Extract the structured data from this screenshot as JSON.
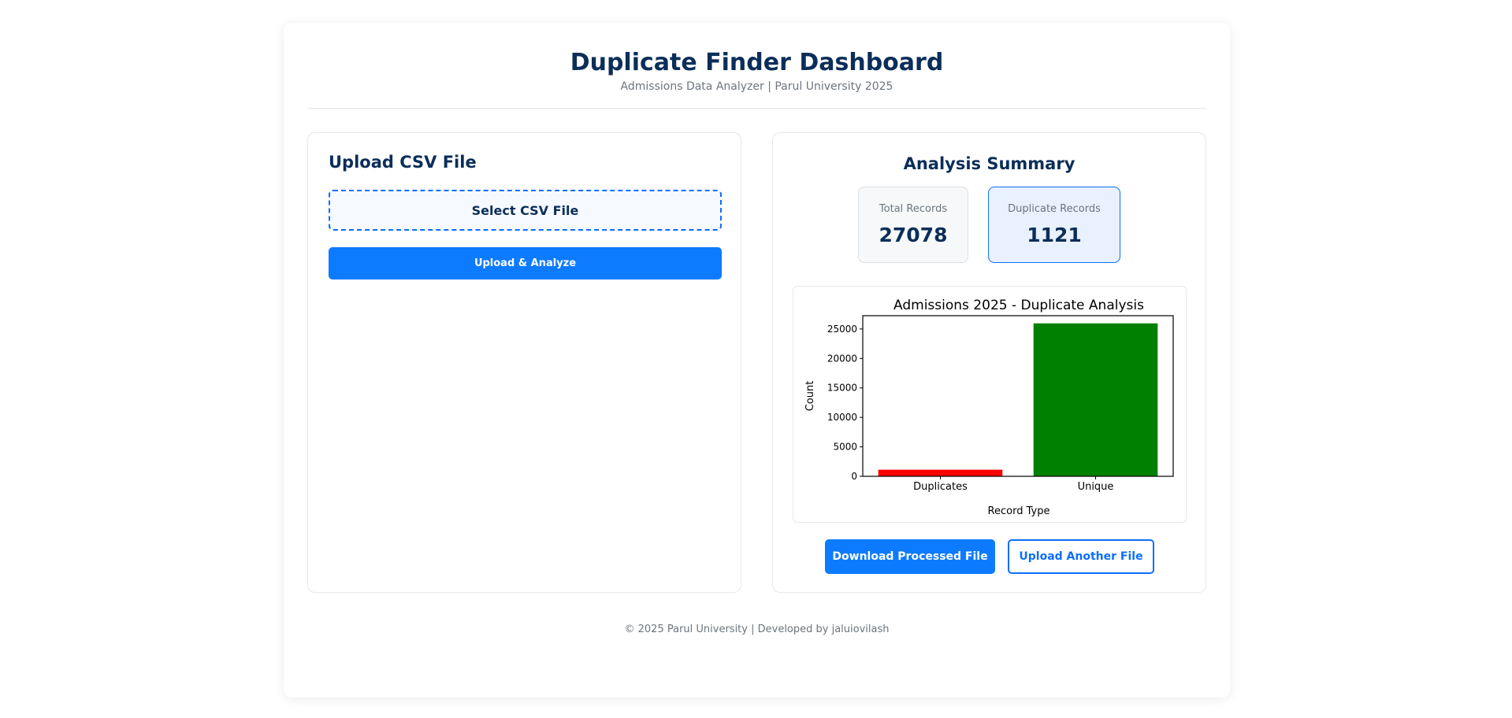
{
  "header": {
    "title": "Duplicate Finder Dashboard",
    "subtitle": "Admissions Data Analyzer | Parul University 2025"
  },
  "upload": {
    "title": "Upload CSV File",
    "select_label": "Select CSV File",
    "button_label": "Upload & Analyze"
  },
  "summary": {
    "title": "Analysis Summary",
    "stats": [
      {
        "label": "Total Records",
        "value": "27078"
      },
      {
        "label": "Duplicate Records",
        "value": "1121"
      }
    ]
  },
  "chart_data": {
    "type": "bar",
    "title": "Admissions 2025 - Duplicate Analysis",
    "xlabel": "Record Type",
    "ylabel": "Count",
    "categories": [
      "Duplicates",
      "Unique"
    ],
    "values": [
      1121,
      25957
    ],
    "colors": [
      "#ff0000",
      "#008000"
    ],
    "ylim": [
      0,
      27255
    ],
    "yticks": [
      0,
      5000,
      10000,
      15000,
      20000,
      25000
    ],
    "grid": false
  },
  "actions": {
    "download_label": "Download Processed File",
    "again_label": "Upload Another File"
  },
  "footer": {
    "text": "© 2025 Parul University | Developed by jaluiovilash"
  }
}
